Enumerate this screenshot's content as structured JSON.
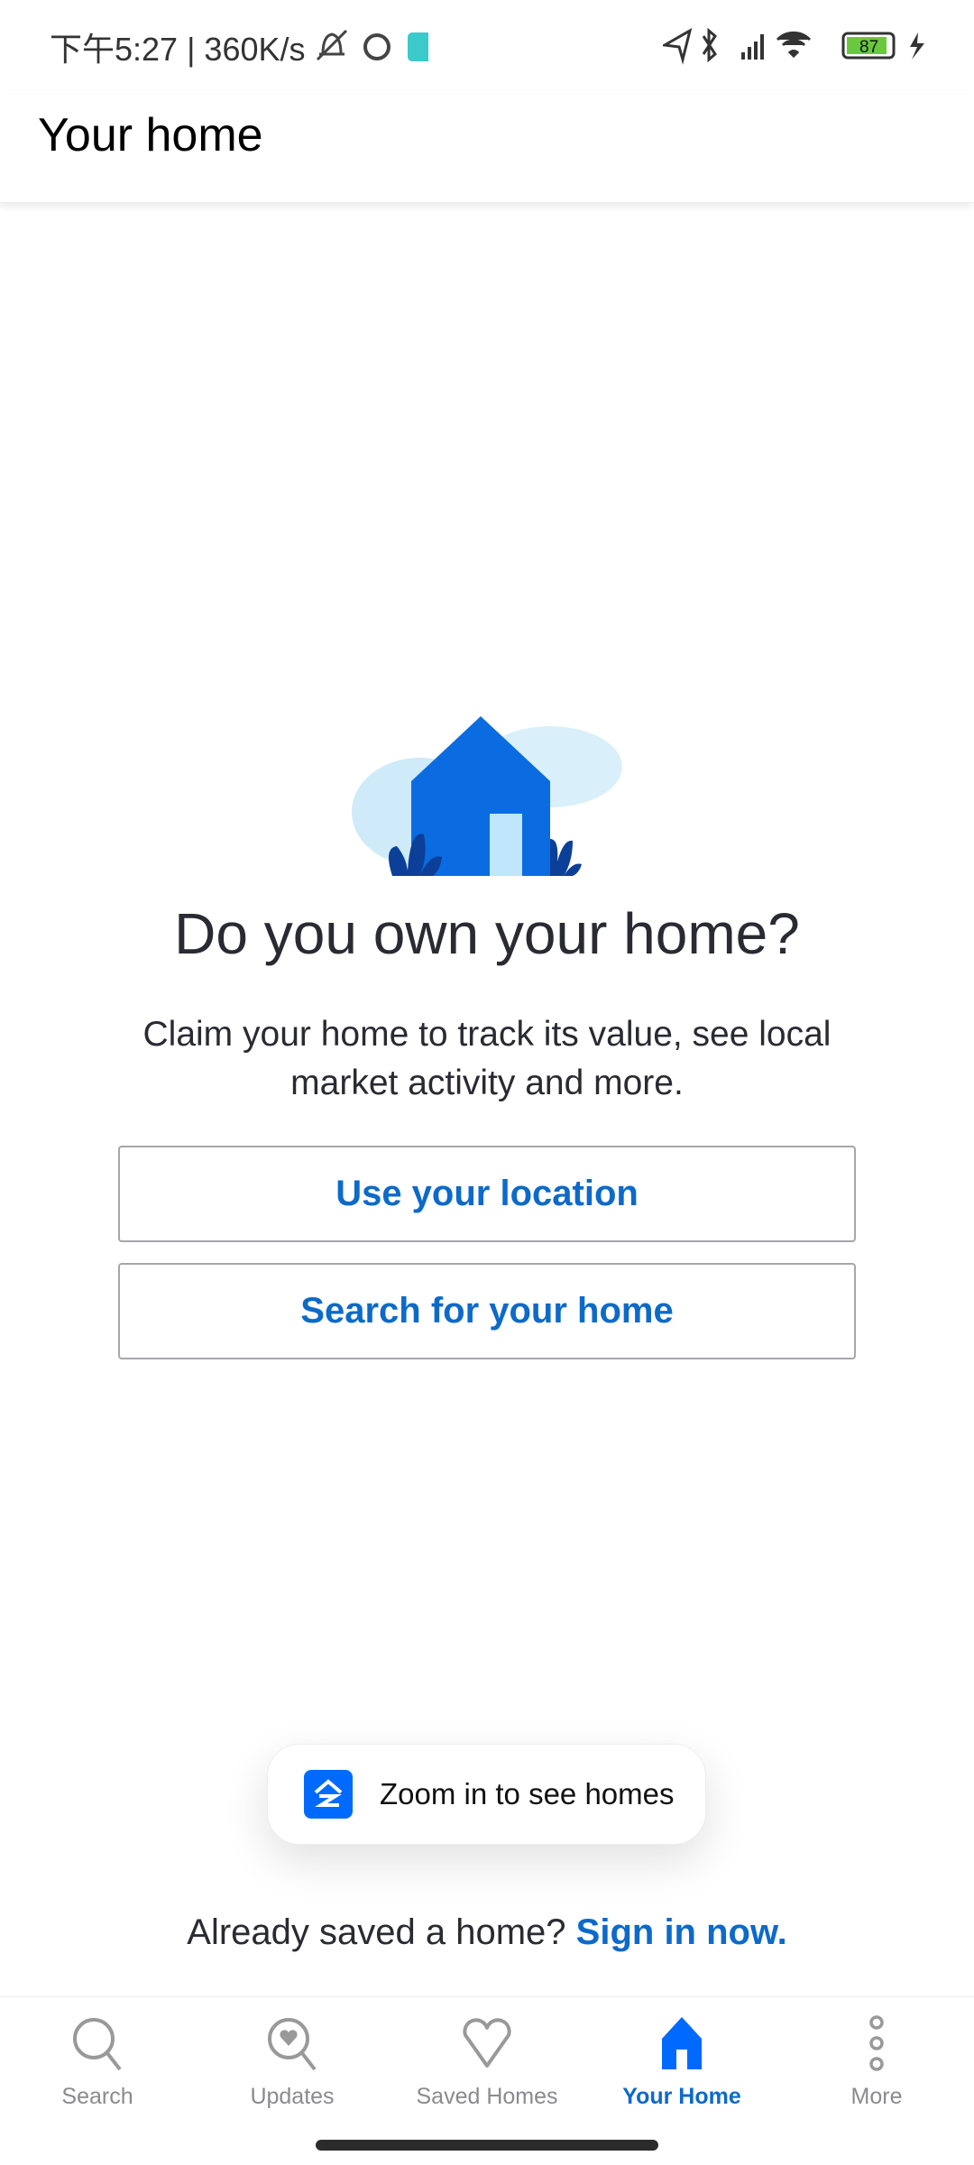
{
  "status_bar": {
    "time": "下午5:27 | 360K/s",
    "battery": "87"
  },
  "header": {
    "title": "Your home"
  },
  "main": {
    "heading": "Do you own your home?",
    "subtitle": "Claim your home to track its value, see local market activity and more.",
    "use_location": "Use your location",
    "search_home": "Search for your home"
  },
  "toast": {
    "text": "Zoom in to see homes"
  },
  "signin": {
    "prompt": "Already saved a home?",
    "link": "Sign in now."
  },
  "nav": {
    "items": [
      {
        "label": "Search",
        "icon": "search-icon"
      },
      {
        "label": "Updates",
        "icon": "updates-icon"
      },
      {
        "label": "Saved Homes",
        "icon": "heart-icon"
      },
      {
        "label": "Your Home",
        "icon": "home-icon",
        "active": true
      },
      {
        "label": "More",
        "icon": "more-icon"
      }
    ]
  },
  "colors": {
    "accent": "#006aff",
    "link": "#0d6ac9",
    "nav_inactive": "#8a8a8f"
  }
}
